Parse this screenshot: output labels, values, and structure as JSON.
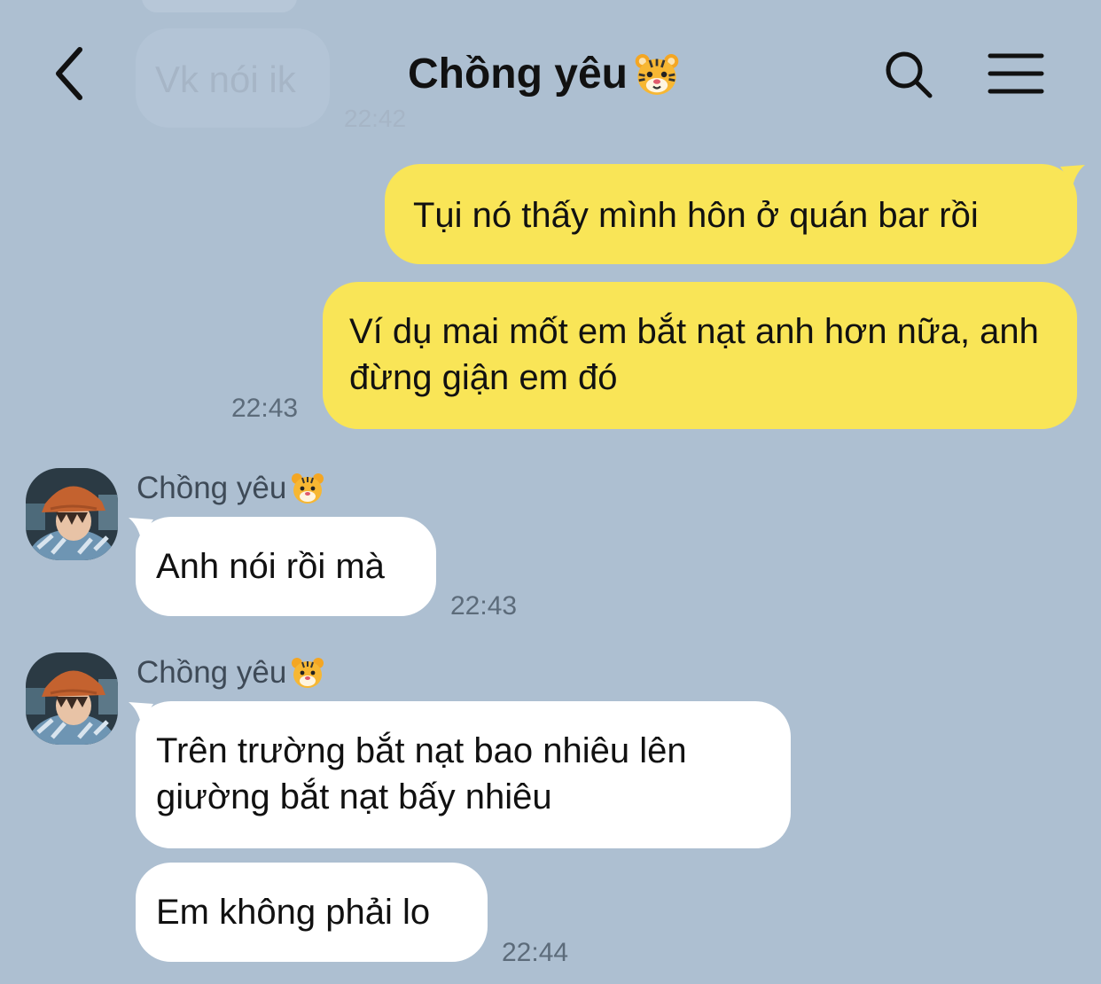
{
  "background_color": "#adbfd1",
  "header": {
    "title": "Chồng yêu",
    "title_emoji": "tiger-face-emoji",
    "back_icon": "chevron-left-icon",
    "search_icon": "search-icon",
    "menu_icon": "hamburger-menu-icon"
  },
  "faded_message": {
    "text": "Vk nói ik",
    "time": "22:42"
  },
  "outgoing": {
    "bubble_color": "#f9e557",
    "messages": [
      {
        "text": "Tụi nó thấy mình hôn ở quán bar rồi"
      },
      {
        "text": "Ví dụ mai mốt em bắt nạt anh hơn nữa, anh đừng giận em đó"
      }
    ],
    "time": "22:43"
  },
  "incoming": {
    "bubble_color": "#ffffff",
    "groups": [
      {
        "sender": "Chồng yêu",
        "messages": [
          {
            "text": "Anh nói rồi mà"
          }
        ],
        "time": "22:43"
      },
      {
        "sender": "Chồng yêu",
        "messages": [
          {
            "text": "Trên trường bắt nạt bao nhiêu lên giường bắt nạt bấy nhiêu"
          },
          {
            "text": "Em không phải lo"
          }
        ],
        "time": "22:44"
      }
    ]
  }
}
